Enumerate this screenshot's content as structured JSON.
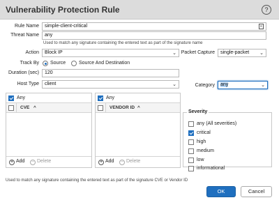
{
  "dialog": {
    "title": "Vulnerability Protection Rule",
    "help_icon": "?"
  },
  "form": {
    "rule_name_label": "Rule Name",
    "rule_name_value": "simple-client-critical",
    "threat_name_label": "Threat Name",
    "threat_name_value": "any",
    "threat_name_hint": "Used to match any signature containing the entered text as part of the signature name",
    "action_label": "Action",
    "action_value": "Block IP",
    "packet_capture_label": "Packet Capture",
    "packet_capture_value": "single-packet",
    "track_by_label": "Track By",
    "track_by_option_source": "Source",
    "track_by_option_source_dest": "Source And Destination",
    "track_by_selected": "Source",
    "duration_label": "Duration (sec)",
    "duration_value": "120",
    "host_type_label": "Host Type",
    "host_type_value": "client",
    "category_label": "Category",
    "category_value": "any"
  },
  "cve_panel": {
    "any_label": "Any",
    "any_checked": true,
    "column": "CVE",
    "add_label": "Add",
    "delete_label": "Delete"
  },
  "vendor_panel": {
    "any_label": "Any",
    "any_checked": true,
    "column": "VENDOR ID",
    "add_label": "Add",
    "delete_label": "Delete"
  },
  "severity": {
    "title": "Severity",
    "items": [
      {
        "label": "any (All severities)",
        "checked": false
      },
      {
        "label": "critical",
        "checked": true
      },
      {
        "label": "high",
        "checked": false
      },
      {
        "label": "medium",
        "checked": false
      },
      {
        "label": "low",
        "checked": false
      },
      {
        "label": "informational",
        "checked": false
      }
    ]
  },
  "footer": {
    "hint": "Used to match any signature containing the entered text as part of the signature CVE or Vendor ID",
    "ok_label": "OK",
    "cancel_label": "Cancel"
  },
  "colors": {
    "accent": "#1f6fbf",
    "titlebar": "#dcdcdc"
  },
  "icons": [
    "help-icon",
    "dropdown-caret-icon",
    "sort-ascending-icon",
    "add-icon",
    "delete-icon",
    "field-options-icon"
  ]
}
